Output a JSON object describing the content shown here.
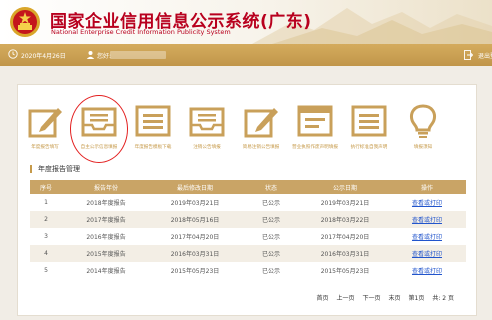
{
  "header": {
    "title_cn": "国家企业信用信息公示系统(广东)",
    "title_en": "National Enterprise Credit Information Publicity System"
  },
  "navbar": {
    "date": "2020年4月26日",
    "account_label": "您好:",
    "logout": "退出登录"
  },
  "tiles": [
    {
      "label": "年度报告填写",
      "icon": "edit-icon"
    },
    {
      "label": "自主公示信息填报",
      "icon": "inbox-icon"
    },
    {
      "label": "年度报告模板下载",
      "icon": "document-list-icon"
    },
    {
      "label": "注销公告填报",
      "icon": "inbox-icon"
    },
    {
      "label": "简易注销公告填报",
      "icon": "edit-icon"
    },
    {
      "label": "营业执照作废声明填报",
      "icon": "browser-window-icon"
    },
    {
      "label": "执行标准自我声明",
      "icon": "document-list-icon"
    },
    {
      "label": "填报须知",
      "icon": "lightbulb-icon"
    }
  ],
  "section_title": "年度报告管理",
  "table": {
    "headers": [
      "序号",
      "报告年份",
      "最后修改日期",
      "状态",
      "公示日期",
      "操作"
    ],
    "rows": [
      {
        "no": "1",
        "year": "2018年度报告",
        "modified": "2019年03月21日",
        "status": "已公示",
        "pub": "2019年03月21日",
        "action": "查看或打印"
      },
      {
        "no": "2",
        "year": "2017年度报告",
        "modified": "2018年05月16日",
        "status": "已公示",
        "pub": "2018年03月22日",
        "action": "查看或打印"
      },
      {
        "no": "3",
        "year": "2016年度报告",
        "modified": "2017年04月20日",
        "status": "已公示",
        "pub": "2017年04月20日",
        "action": "查看或打印"
      },
      {
        "no": "4",
        "year": "2015年度报告",
        "modified": "2016年03月31日",
        "status": "已公示",
        "pub": "2016年03月31日",
        "action": "查看或打印"
      },
      {
        "no": "5",
        "year": "2014年度报告",
        "modified": "2015年05月23日",
        "status": "已公示",
        "pub": "2015年05月23日",
        "action": "查看或打印"
      }
    ]
  },
  "pager": {
    "first": "首页",
    "prev": "上一页",
    "next": "下一页",
    "last": "末页",
    "page_info": "第1页",
    "total": "共: 2 页"
  },
  "colors": {
    "brand_red": "#b8001e",
    "gold": "#c69a4a",
    "link": "#2255cc",
    "annotation_circle": "#e32020"
  }
}
